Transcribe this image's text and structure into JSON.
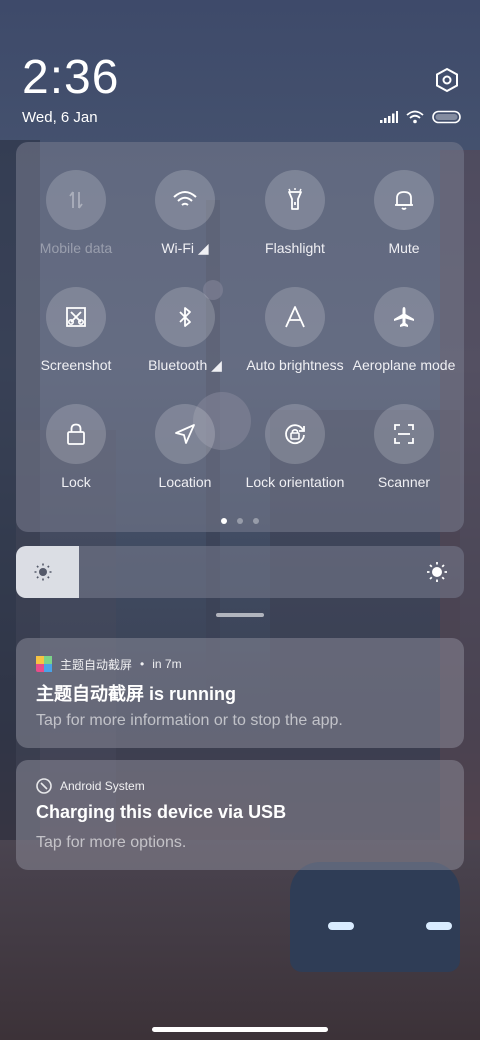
{
  "status": {
    "time": "2:36",
    "date": "Wed, 6 Jan"
  },
  "quick_settings": {
    "tiles": [
      {
        "label": "Mobile data",
        "icon": "mobile-data-icon",
        "enabled": false
      },
      {
        "label": "Wi-Fi",
        "icon": "wifi-icon",
        "enabled": true
      },
      {
        "label": "Flashlight",
        "icon": "flashlight-icon",
        "enabled": true
      },
      {
        "label": "Mute",
        "icon": "bell-icon",
        "enabled": true
      },
      {
        "label": "Screenshot",
        "icon": "screenshot-icon",
        "enabled": true
      },
      {
        "label": "Bluetooth",
        "icon": "bluetooth-icon",
        "enabled": true
      },
      {
        "label": "Auto brightness",
        "icon": "auto-brightness-icon",
        "enabled": true
      },
      {
        "label": "Aeroplane mode",
        "icon": "airplane-icon",
        "enabled": true
      },
      {
        "label": "Lock",
        "icon": "lock-icon",
        "enabled": true
      },
      {
        "label": "Location",
        "icon": "location-icon",
        "enabled": true
      },
      {
        "label": "Lock orientation",
        "icon": "rotation-lock-icon",
        "enabled": true
      },
      {
        "label": "Scanner",
        "icon": "scanner-icon",
        "enabled": true
      }
    ],
    "page_count": 3,
    "active_page": 1
  },
  "brightness": {
    "level": 0.14
  },
  "notifications": [
    {
      "app": "主题自动截屏",
      "time": "in 7m",
      "title": "主题自动截屏 is running",
      "body": "Tap for more information or to stop the app."
    },
    {
      "app": "Android System",
      "title": "Charging this device via USB",
      "body": "Tap for more options."
    }
  ],
  "colors": {
    "panel": "#787c8e",
    "accent": "#ffffff"
  }
}
